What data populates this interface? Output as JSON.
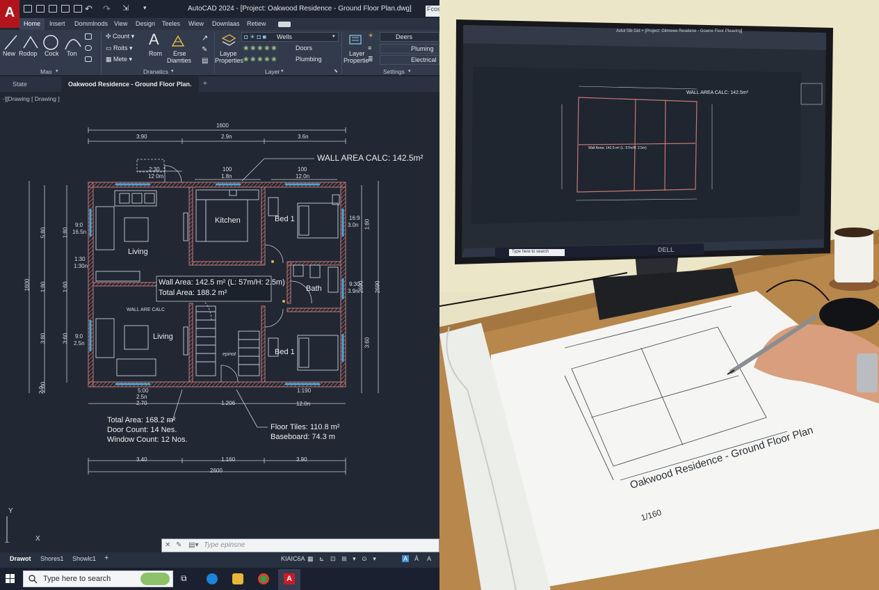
{
  "app": {
    "window_title": "AutoCAD 2024 - [Project: Oakwood Residence - Ground Floor Plan.dwg]",
    "corner_label": "Fcos",
    "logo_letter": "A"
  },
  "ribbon": {
    "tabs": [
      "Home",
      "Insert",
      "Dommlnods",
      "View",
      "Design",
      "Teeles",
      "Wiew",
      "Downlaas",
      "Retiew"
    ],
    "active_tab": "Home",
    "tools": {
      "new": "New",
      "rodop": "Rodop",
      "cock": "Cock",
      "ton": "Ton",
      "count": "Count",
      "roots": "Roits",
      "mete": "Mete",
      "rom": "Rom",
      "erse": "Erse",
      "diamties": "Diamties",
      "layer_properties": "Laype Properties",
      "layer_prop_line1": "Laype",
      "layer_prop_line2": "Properties",
      "walls": "Wells",
      "doors": "Doors",
      "plumbing": "Plumbing",
      "layer_propertie_line1": "Layer",
      "layer_propertie_line2": "Propertie",
      "deers": "Deers",
      "pluming": "Pluming",
      "electrical": "Electrical"
    },
    "groups": {
      "mao": "Mao",
      "dranatics": "Dranatics",
      "layer": "Layer",
      "settings": "Settings"
    }
  },
  "doc_tabs": [
    "State",
    "Oakwood Residence - Ground Floor Plan."
  ],
  "viewport_label": "-][Drawing [ Drawing ]",
  "plan": {
    "top_dims": {
      "total": "1600",
      "left": "3:90",
      "mid": "2.9n",
      "right": "3.6n"
    },
    "callout_wall": "WALL AREA CALC: 142.5m²",
    "top_sub_dims": [
      {
        "a": "2:30",
        "b": "12 0m"
      },
      {
        "a": "100",
        "b": "1.8n"
      },
      {
        "a": "100",
        "b": "12.0n"
      }
    ],
    "rooms": {
      "living_top": "Living",
      "kitchen": "Kitchen",
      "bed1_top": "Bed 1",
      "bath": "Bath",
      "living_bottom": "Living",
      "bed1_bottom": "Bed 1",
      "wall_calc_label": "WALL ARE CALC",
      "epinot": "epinot"
    },
    "calc_box": {
      "line1": "Wall Area: 142.5 m² (L: 57m/H: 2.5m)",
      "line2": "Total Area: 188.2 m²"
    },
    "left_dims": {
      "outer": "1600",
      "inner_a": "5:80",
      "inner_b": "1:80",
      "inner_c": "3:60",
      "inner_d": "3:80",
      "inner_e": "2:00",
      "inner_f": "1:80",
      "inner_g": "1:60",
      "w1a": "9:0",
      "w1b": "16.5n",
      "w2a": "1:30",
      "w2b": "1:30n",
      "w3a": "9:0",
      "w3b": "2.5n",
      "w4": "2.0"
    },
    "right_dims": {
      "outer_a": "2690",
      "outer_b": "2690",
      "inner_a": "1:80",
      "inner_b": "1:60",
      "inner_c": "3:60",
      "w1a": "16:9",
      "w1b": "3.0n",
      "w2a": "9:30",
      "w2b": "3.9n"
    },
    "bottom_sub_dims": [
      {
        "a": "5:00",
        "b": "2.5n"
      },
      {
        "a": "1:190",
        "b": "12.0n"
      }
    ],
    "bottom_dims1": {
      "left": "2.70",
      "mid": "1.206",
      "right": "12.0n"
    },
    "summary_left": [
      "Total Area: 168.2 m²",
      "Door Count: 14 Nes.",
      "Window Count: 12 Nos."
    ],
    "summary_right": [
      "Floor Tiles: 110.8 m²",
      "Baseboard: 74.3 m"
    ],
    "bottom_dims2": {
      "left": "3.40",
      "mid": "1.160",
      "right": "3.90",
      "total": "2600"
    }
  },
  "axis": {
    "x": "X",
    "y": "Y"
  },
  "command_line": {
    "placeholder": "Type epinsne"
  },
  "status": {
    "tabs": [
      "Drawot",
      "Shores1",
      "Showlc1"
    ],
    "active_tab": "Drawot",
    "coords": "KIAIC6A"
  },
  "taskbar": {
    "search_placeholder": "Type here to search"
  },
  "photo": {
    "sheet_title": "Oakwood Residence - Ground Floor Plan",
    "sheet_scale": "1/160",
    "monitor_brand": "DELL",
    "monitor_title": "Avtol Sib Gid + [Project: Gilmewe Residene - Gowne Fleor Pleaving]",
    "monitor_wall_callout": "WALL AREA CALC: 142.5m²",
    "monitor_calc": "Wall Aena: 142.5 m² (L: 57m/H: 2.5m)",
    "monitor_taskbar_search": "Type here to search"
  },
  "colors": {
    "canvas": "#212833",
    "wall": "#c97874",
    "dim": "#c9cfd8",
    "window": "#4aa7d6",
    "accent": "#b3141c"
  }
}
